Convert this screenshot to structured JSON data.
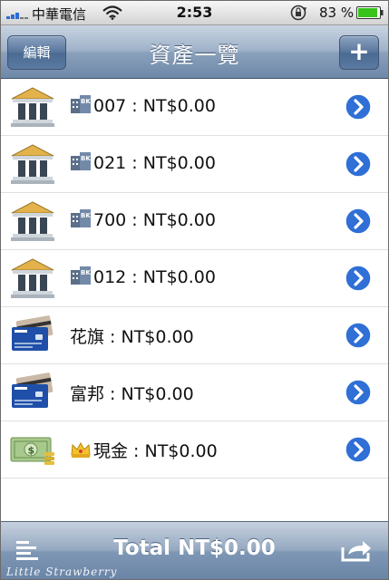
{
  "status_bar": {
    "carrier": "中華電信",
    "time": "2:53",
    "battery_percent": "83 %",
    "signal_bars": 5,
    "battery_level": 0.83
  },
  "nav": {
    "title": "資產一覽",
    "edit_label": "編輯",
    "add_label": "+"
  },
  "accounts": [
    {
      "type": "bank",
      "code": "007",
      "label": "007 : NT$0.00"
    },
    {
      "type": "bank",
      "code": "021",
      "label": "021 : NT$0.00"
    },
    {
      "type": "bank",
      "code": "700",
      "label": "700 : NT$0.00"
    },
    {
      "type": "bank",
      "code": "012",
      "label": "012 : NT$0.00"
    },
    {
      "type": "credit-card",
      "label": "花旗 : NT$0.00"
    },
    {
      "type": "credit-card",
      "label": "富邦 : NT$0.00"
    },
    {
      "type": "cash",
      "label": "現金 : NT$0.00"
    }
  ],
  "toolbar": {
    "total_label": "Total NT$0.00",
    "watermark": "Little Strawberry"
  },
  "icons": {
    "bank": "bank-building-icon",
    "credit_card": "credit-card-icon",
    "cash": "cash-bills-icon",
    "bk_badge": "bk-building-icon",
    "crown": "crown-icon",
    "disclosure": "disclosure-arrow-icon",
    "menu": "menu-icon",
    "share": "share-icon"
  },
  "colors": {
    "nav_top": "#c9d4e2",
    "nav_bottom": "#6e88a8",
    "disclosure_blue": "#2f6fd6",
    "signal_blue": "#2c6ad6",
    "battery_green": "#39c41c"
  }
}
